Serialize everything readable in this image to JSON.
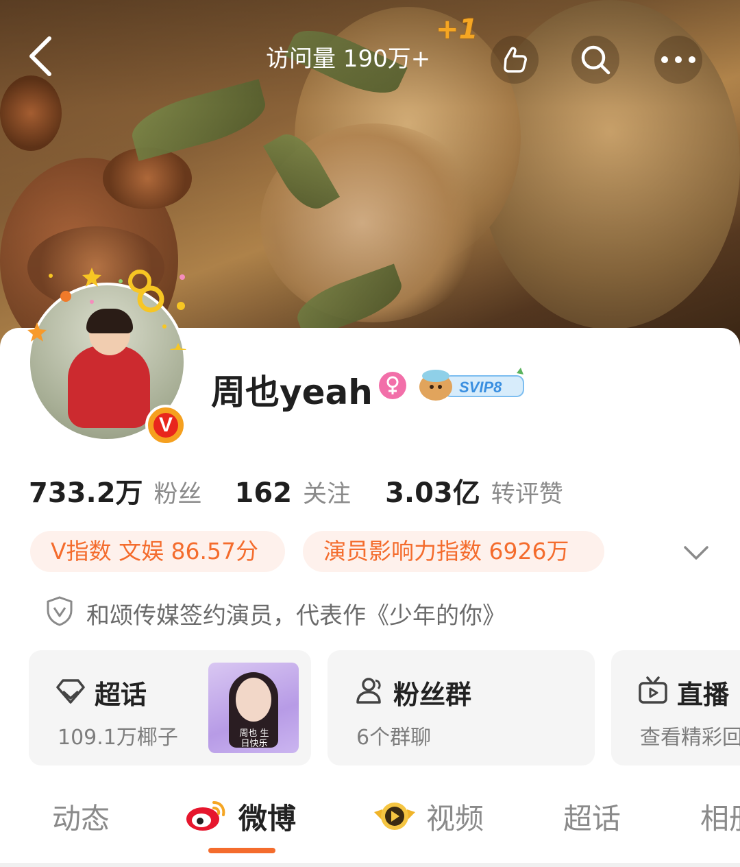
{
  "header": {
    "visits_label": "访问量 190万+",
    "plus_one": "+1",
    "icons": [
      "back-arrow-icon",
      "thumbs-up-icon",
      "search-icon",
      "more-icon"
    ]
  },
  "profile": {
    "name": "周也yeah",
    "gender_icon": "female-icon",
    "vip_badge": "SVIP8",
    "verified_badge": "V",
    "accent_color": "#f46c2d"
  },
  "stats": [
    {
      "value": "733.2万",
      "label": "粉丝"
    },
    {
      "value": "162",
      "label": "关注"
    },
    {
      "value": "3.03亿",
      "label": "转评赞"
    }
  ],
  "tags": [
    {
      "text": "V指数 文娱 86.57分"
    },
    {
      "text": "演员影响力指数 6926万"
    }
  ],
  "verification": "和颂传媒签约演员，代表作《少年的你》",
  "features": [
    {
      "title": "超话",
      "subtitle": "109.1万椰子",
      "thumb_text": "周也 生日快乐"
    },
    {
      "title": "粉丝群",
      "subtitle": "6个群聊"
    },
    {
      "title": "直播",
      "subtitle": "查看精彩回"
    }
  ],
  "tabs": [
    {
      "label": "动态"
    },
    {
      "label": "微博"
    },
    {
      "label": "视频"
    },
    {
      "label": "超话"
    },
    {
      "label": "相册"
    }
  ],
  "active_tab": "微博"
}
